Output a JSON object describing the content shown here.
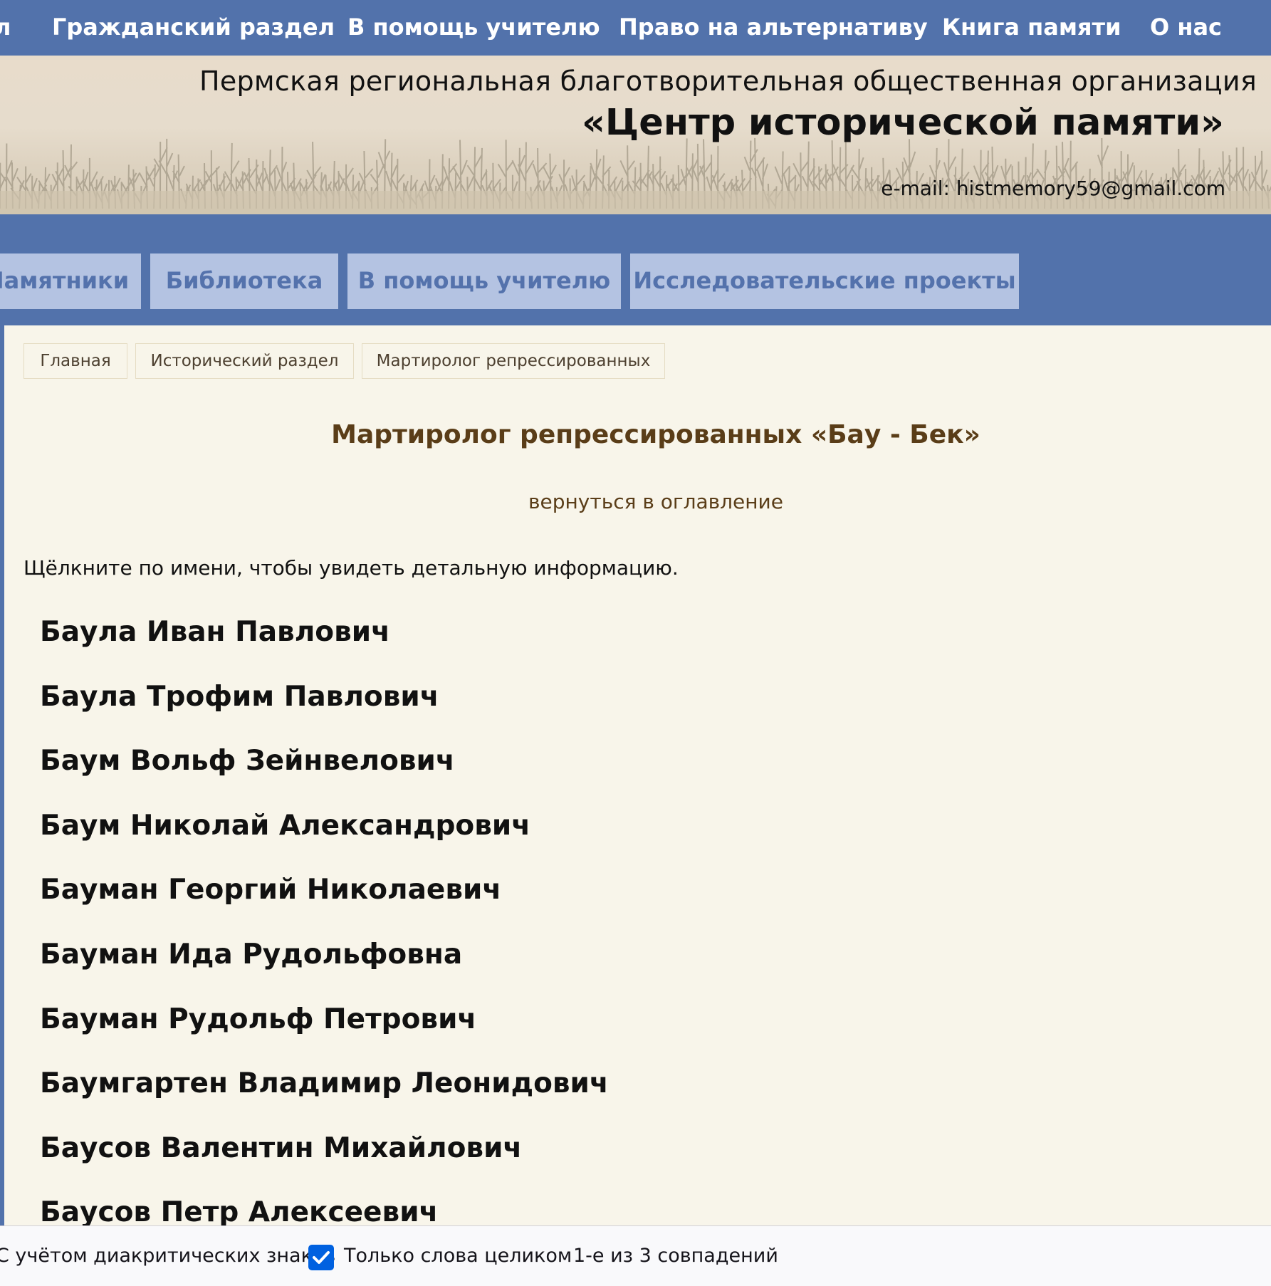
{
  "top_nav": {
    "items": [
      {
        "label": "л"
      },
      {
        "label": "Гражданский раздел"
      },
      {
        "label": "В помощь учителю"
      },
      {
        "label": "Право на альтернативу"
      },
      {
        "label": "Книга памяти"
      },
      {
        "label": "О нас"
      }
    ]
  },
  "header": {
    "org_line": "Пермская региональная благотворительная общественная организация",
    "org_name": "«Центр исторической памяти»",
    "email": "e-mail: histmemory59@gmail.com"
  },
  "sub_nav": {
    "tabs": [
      {
        "label": "Памятники"
      },
      {
        "label": "Библиотека"
      },
      {
        "label": "В помощь учителю"
      },
      {
        "label": "Исследовательские проекты"
      }
    ]
  },
  "breadcrumb": {
    "items": [
      {
        "label": "Главная"
      },
      {
        "label": "Исторический раздел"
      },
      {
        "label": "Мартиролог репрессированных"
      }
    ]
  },
  "page": {
    "title": "Мартиролог репрессированных «Бау - Бек»",
    "back_link": "вернуться в оглавление",
    "hint": "Щёлкните по имени, чтобы увидеть детальную информацию."
  },
  "names": [
    "Баула Иван Павлович",
    "Баула Трофим Павлович",
    "Баум Вольф Зейнвелович",
    "Баум Николай Александрович",
    "Бауман Георгий Николаевич",
    "Бауман Ида Рудольфовна",
    "Бауман Рудольф Петрович",
    "Баумгартен Владимир Леонидович",
    "Баусов Валентин Михайлович",
    "Баусов Петр Алексеевич"
  ],
  "find_bar": {
    "diacritics_label": "С учётом диакритических знаков",
    "whole_words_label": "Только слова целиком",
    "whole_words_checked": true,
    "match_status": "1-е из 3 совпадений"
  },
  "colors": {
    "nav_blue": "#5272ab",
    "tab_bg": "#b4c3e2",
    "tab_text": "#5472ac",
    "content_bg": "#f8f5ea",
    "title_brown": "#5a3d18",
    "checkbox_blue": "#0061e0"
  }
}
